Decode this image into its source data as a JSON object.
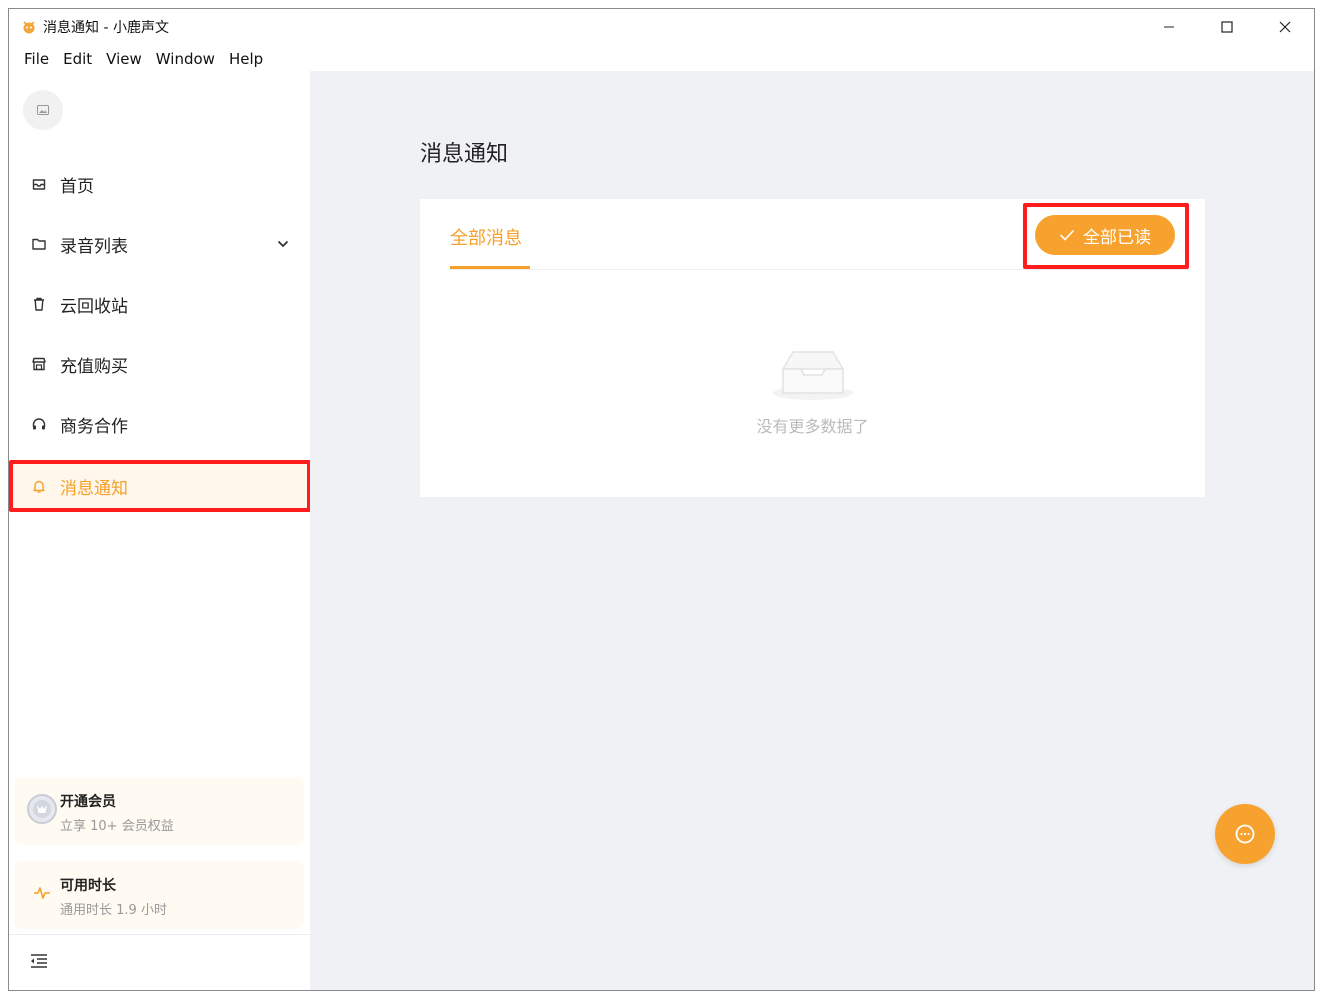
{
  "window": {
    "title": "消息通知 - 小鹿声文"
  },
  "menu": {
    "file": "File",
    "edit": "Edit",
    "view": "View",
    "window": "Window",
    "help": "Help"
  },
  "sidebar": {
    "items": [
      {
        "label": "首页",
        "icon": "inbox-icon"
      },
      {
        "label": "录音列表",
        "icon": "folder-icon"
      },
      {
        "label": "云回收站",
        "icon": "trash-icon"
      },
      {
        "label": "充值购买",
        "icon": "shop-icon"
      },
      {
        "label": "商务合作",
        "icon": "headset-icon"
      },
      {
        "label": "消息通知",
        "icon": "bell-icon"
      }
    ],
    "active_item": "消息通知",
    "vip_card": {
      "title": "开通会员",
      "subtitle": "立享 10+ 会员权益"
    },
    "time_card": {
      "title": "可用时长",
      "subtitle": "通用时长 1.9 小时"
    }
  },
  "main": {
    "title": "消息通知",
    "tab": "全部消息",
    "read_all_button": "全部已读",
    "empty_text": "没有更多数据了"
  },
  "colors": {
    "accent": "#f5a02a",
    "highlight": "#ff1c1c",
    "main_bg": "#f0f1f4"
  }
}
